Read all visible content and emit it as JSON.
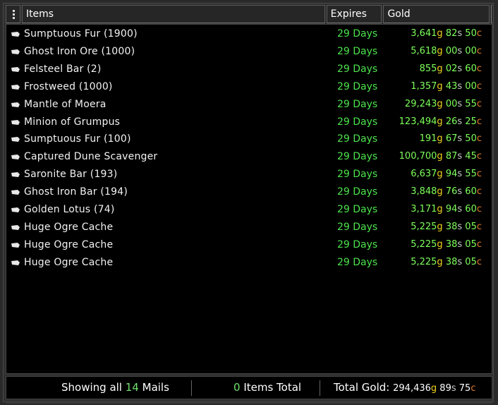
{
  "header": {
    "menu_icon": "vertical-dots-icon",
    "items_label": "Items",
    "expires_label": "Expires",
    "gold_label": "Gold"
  },
  "rows": [
    {
      "name": "Sumptuous Fur (1900)",
      "expires": "29 Days",
      "gold": "3,641",
      "silver": "82",
      "copper": "50"
    },
    {
      "name": "Ghost Iron Ore (1000)",
      "expires": "29 Days",
      "gold": "5,618",
      "silver": "00",
      "copper": "00"
    },
    {
      "name": "Felsteel Bar (2)",
      "expires": "29 Days",
      "gold": "855",
      "silver": "02",
      "copper": "60"
    },
    {
      "name": "Frostweed (1000)",
      "expires": "29 Days",
      "gold": "1,357",
      "silver": "43",
      "copper": "00"
    },
    {
      "name": "Mantle of Moera",
      "expires": "29 Days",
      "gold": "29,243",
      "silver": "00",
      "copper": "55"
    },
    {
      "name": "Minion of Grumpus",
      "expires": "29 Days",
      "gold": "123,494",
      "silver": "26",
      "copper": "25"
    },
    {
      "name": "Sumptuous Fur (100)",
      "expires": "29 Days",
      "gold": "191",
      "silver": "67",
      "copper": "50"
    },
    {
      "name": "Captured Dune Scavenger",
      "expires": "29 Days",
      "gold": "100,700",
      "silver": "87",
      "copper": "45"
    },
    {
      "name": "Saronite Bar (193)",
      "expires": "29 Days",
      "gold": "6,637",
      "silver": "94",
      "copper": "55"
    },
    {
      "name": "Ghost Iron Bar (194)",
      "expires": "29 Days",
      "gold": "3,848",
      "silver": "76",
      "copper": "60"
    },
    {
      "name": "Golden Lotus (74)",
      "expires": "29 Days",
      "gold": "3,171",
      "silver": "94",
      "copper": "60"
    },
    {
      "name": "Huge Ogre Cache",
      "expires": "29 Days",
      "gold": "5,225",
      "silver": "38",
      "copper": "05"
    },
    {
      "name": "Huge Ogre Cache",
      "expires": "29 Days",
      "gold": "5,225",
      "silver": "38",
      "copper": "05"
    },
    {
      "name": "Huge Ogre Cache",
      "expires": "29 Days",
      "gold": "5,225",
      "silver": "38",
      "copper": "05"
    }
  ],
  "units": {
    "gold": "g",
    "silver": "s",
    "copper": "c"
  },
  "footer": {
    "showing_prefix": "Showing all",
    "mail_count": "14",
    "showing_suffix": "Mails",
    "items_count": "0",
    "items_suffix": "Items Total",
    "total_label": "Total Gold:",
    "total_gold": "294,436",
    "total_silver": "89",
    "total_copper": "75"
  },
  "colors": {
    "background": "#000000",
    "expires": "#4de34d",
    "highlight": "#6ee06e",
    "gold_unit": "#f2d21c",
    "copper_unit": "#e07a2a"
  }
}
